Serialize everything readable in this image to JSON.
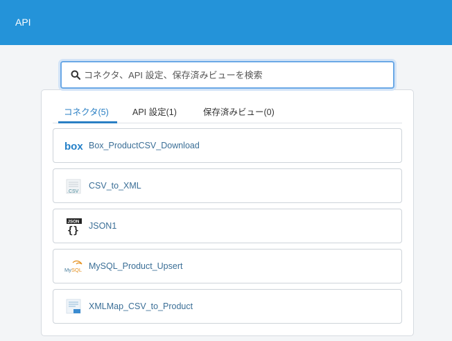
{
  "header": {
    "title": "API"
  },
  "search": {
    "placeholder": "コネクタ、API 設定、保存済みビューを検索",
    "value": ""
  },
  "tabs": [
    {
      "label": "コネクタ(5)",
      "active": true
    },
    {
      "label": "API 設定(1)",
      "active": false
    },
    {
      "label": "保存済みビュー(0)",
      "active": false
    }
  ],
  "connectors": [
    {
      "label": "Box_ProductCSV_Download",
      "icon": "box-icon"
    },
    {
      "label": "CSV_to_XML",
      "icon": "csv-icon"
    },
    {
      "label": "JSON1",
      "icon": "json-icon"
    },
    {
      "label": "MySQL_Product_Upsert",
      "icon": "mysql-icon"
    },
    {
      "label": "XMLMap_CSV_to_Product",
      "icon": "xmlmap-icon"
    }
  ],
  "colors": {
    "header": "#2493d9",
    "accent": "#2a7fc4",
    "link_text": "#3a6e96"
  }
}
